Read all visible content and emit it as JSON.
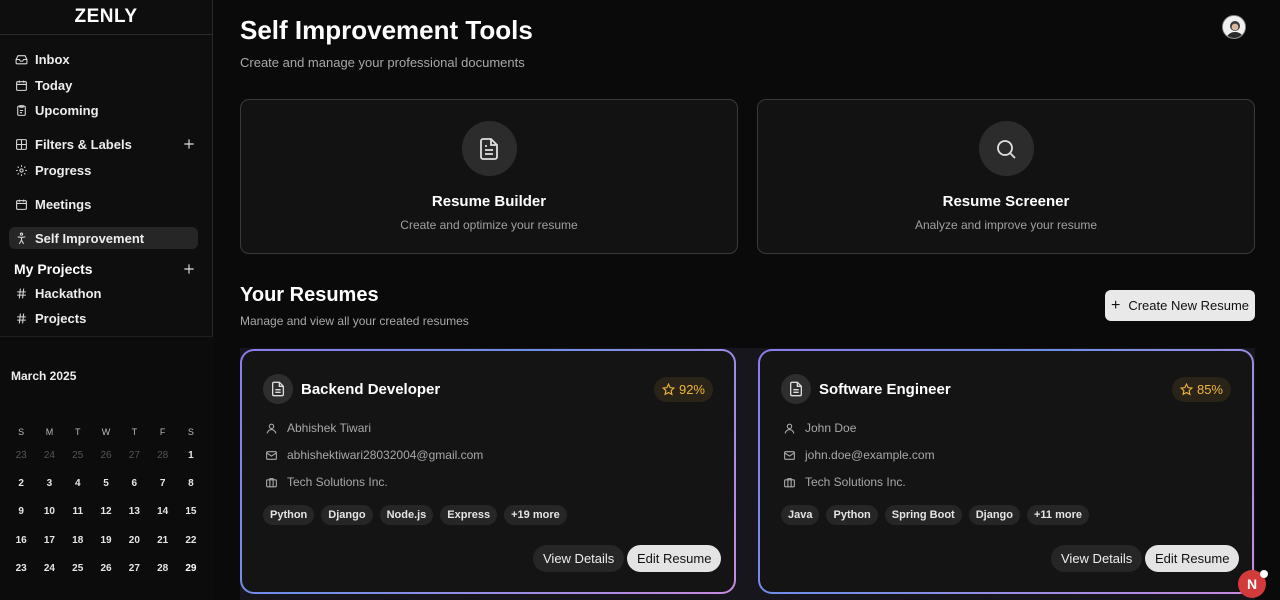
{
  "app": {
    "logo": "ZENLY"
  },
  "sidebar": {
    "items": [
      {
        "label": "Inbox",
        "icon": "inbox-icon"
      },
      {
        "label": "Today",
        "icon": "calendar-icon"
      },
      {
        "label": "Upcoming",
        "icon": "clipboard-icon"
      },
      {
        "label": "Filters & Labels",
        "icon": "grid-icon"
      },
      {
        "label": "Progress",
        "icon": "gear-icon"
      },
      {
        "label": "Meetings",
        "icon": "calendar-icon"
      },
      {
        "label": "Self Improvement",
        "icon": "person-icon",
        "active": true
      }
    ],
    "projects_heading": "My Projects",
    "projects": [
      {
        "label": "Hackathon",
        "icon": "hash-icon"
      },
      {
        "label": "Projects",
        "icon": "hash-icon"
      }
    ]
  },
  "calendar": {
    "month": "March 2025",
    "days_of_week": [
      "S",
      "M",
      "T",
      "W",
      "T",
      "F",
      "S"
    ],
    "weeks": [
      [
        "23",
        "24",
        "25",
        "26",
        "27",
        "28",
        "1"
      ],
      [
        "2",
        "3",
        "4",
        "5",
        "6",
        "7",
        "8"
      ],
      [
        "9",
        "10",
        "11",
        "12",
        "13",
        "14",
        "15"
      ],
      [
        "16",
        "17",
        "18",
        "19",
        "20",
        "21",
        "22"
      ],
      [
        "23",
        "24",
        "25",
        "26",
        "27",
        "28",
        "29"
      ]
    ],
    "today": "29"
  },
  "header": {
    "title": "Self Improvement Tools",
    "subtitle": "Create and manage your professional documents"
  },
  "tools": [
    {
      "title": "Resume Builder",
      "subtitle": "Create and optimize your resume",
      "icon": "document-icon"
    },
    {
      "title": "Resume Screener",
      "subtitle": "Analyze and improve your resume",
      "icon": "search-icon"
    }
  ],
  "resumes_section": {
    "title": "Your Resumes",
    "subtitle": "Manage and view all your created resumes",
    "create_label": "Create New Resume"
  },
  "resumes": [
    {
      "title": "Backend Developer",
      "score": "92%",
      "name": "Abhishek Tiwari",
      "email": "abhishektiwari28032004@gmail.com",
      "company": "Tech Solutions Inc.",
      "tags": [
        "Python",
        "Django",
        "Node.js",
        "Express",
        "+19 more"
      ],
      "view_label": "View Details",
      "edit_label": "Edit Resume"
    },
    {
      "title": "Software Engineer",
      "score": "85%",
      "name": "John Doe",
      "email": "john.doe@example.com",
      "company": "Tech Solutions Inc.",
      "tags": [
        "Java",
        "Python",
        "Spring Boot",
        "Django",
        "+11 more"
      ],
      "view_label": "View Details",
      "edit_label": "Edit Resume"
    }
  ],
  "fab": {
    "label": "N"
  },
  "colors": {
    "accent_score": "#f1b73a",
    "card_border_gradient": [
      "#8b7cf0",
      "#6f8fe8",
      "#c98ae0"
    ],
    "fab": "#d23b3b"
  }
}
